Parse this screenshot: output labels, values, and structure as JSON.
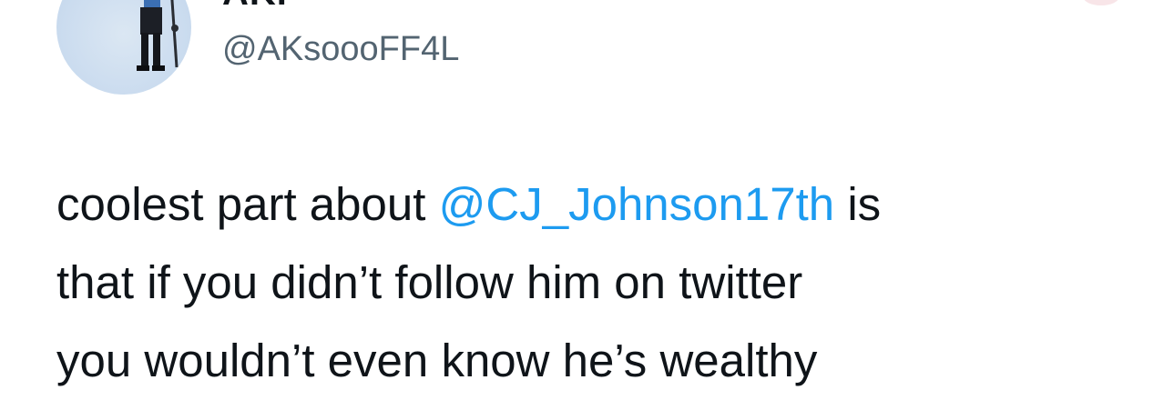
{
  "author": {
    "display_name": "AK.",
    "handle": "@AKsoooFF4L"
  },
  "tweet": {
    "line1_before": "coolest part about ",
    "line1_mention": "@CJ_Johnson17th",
    "line1_after": " is",
    "line2": "that if you didn’t follow him on twitter",
    "line3": "you wouldn’t even know he’s wealthy"
  },
  "colors": {
    "mention": "#1d9bf0",
    "handle": "#536471",
    "text": "#0f1419"
  },
  "icons": [
    "avatar-photo"
  ]
}
